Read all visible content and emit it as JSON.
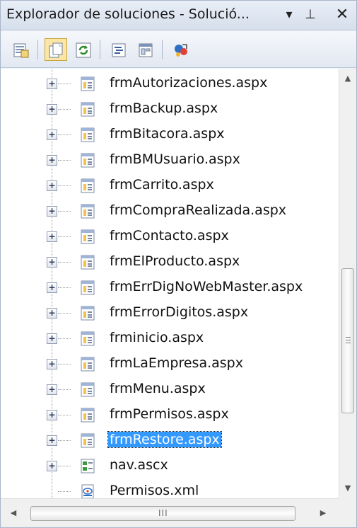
{
  "titlebar": {
    "title": "Explorador de soluciones - Solució...",
    "dropdown_glyph": "▾",
    "pin_glyph": "⊥",
    "close_glyph": "✕"
  },
  "toolbar": {
    "buttons": [
      {
        "name": "properties-button",
        "icon": "properties-icon"
      },
      {
        "name": "show-all-files-button",
        "icon": "show-all-files-icon",
        "pressed": true
      },
      {
        "name": "refresh-button",
        "icon": "refresh-icon"
      },
      {
        "name": "view-code-button",
        "icon": "view-code-icon"
      },
      {
        "name": "view-designer-button",
        "icon": "view-designer-icon"
      },
      {
        "name": "class-diagram-button",
        "icon": "class-diagram-icon"
      }
    ]
  },
  "tree": {
    "items": [
      {
        "label": "frmAutorizaciones.aspx",
        "icon": "aspx-file-icon",
        "expandable": true
      },
      {
        "label": "frmBackup.aspx",
        "icon": "aspx-file-icon",
        "expandable": true
      },
      {
        "label": "frmBitacora.aspx",
        "icon": "aspx-file-icon",
        "expandable": true
      },
      {
        "label": "frmBMUsuario.aspx",
        "icon": "aspx-file-icon",
        "expandable": true
      },
      {
        "label": "frmCarrito.aspx",
        "icon": "aspx-file-icon",
        "expandable": true
      },
      {
        "label": "frmCompraRealizada.aspx",
        "icon": "aspx-file-icon",
        "expandable": true
      },
      {
        "label": "frmContacto.aspx",
        "icon": "aspx-file-icon",
        "expandable": true
      },
      {
        "label": "frmElProducto.aspx",
        "icon": "aspx-file-icon",
        "expandable": true
      },
      {
        "label": "frmErrDigNoWebMaster.aspx",
        "icon": "aspx-file-icon",
        "expandable": true
      },
      {
        "label": "frmErrorDigitos.aspx",
        "icon": "aspx-file-icon",
        "expandable": true
      },
      {
        "label": "frminicio.aspx",
        "icon": "aspx-file-icon",
        "expandable": true
      },
      {
        "label": "frmLaEmpresa.aspx",
        "icon": "aspx-file-icon",
        "expandable": true
      },
      {
        "label": "frmMenu.aspx",
        "icon": "aspx-file-icon",
        "expandable": true
      },
      {
        "label": "frmPermisos.aspx",
        "icon": "aspx-file-icon",
        "expandable": true
      },
      {
        "label": "frmRestore.aspx",
        "icon": "aspx-file-icon",
        "expandable": true,
        "selected": true
      },
      {
        "label": "nav.ascx",
        "icon": "ascx-control-icon",
        "expandable": true
      },
      {
        "label": "Permisos.xml",
        "icon": "xml-file-icon",
        "expandable": false
      }
    ]
  },
  "scrollbars": {
    "vertical": {
      "up_glyph": "▲",
      "down_glyph": "▼",
      "grip": "≡"
    },
    "horizontal": {
      "left_glyph": "◀",
      "right_glyph": "▶",
      "grip": "III"
    }
  }
}
